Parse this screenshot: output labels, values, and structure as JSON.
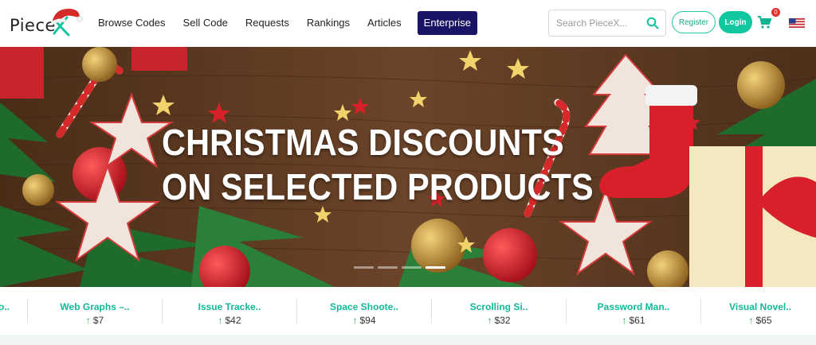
{
  "brand": {
    "name": "Piece"
  },
  "nav": {
    "items": [
      {
        "label": "Browse Codes"
      },
      {
        "label": "Sell Code"
      },
      {
        "label": "Requests"
      },
      {
        "label": "Rankings"
      },
      {
        "label": "Articles"
      }
    ],
    "enterprise_label": "Enterprise",
    "search_placeholder": "Search PieceX...",
    "register_label": "Register",
    "login_label": "Login",
    "cart_count": "0",
    "accent_color": "#10c79f",
    "enterprise_color": "#1a1466"
  },
  "hero": {
    "title_line1": "CHRISTMAS DISCOUNTS",
    "title_line2": "ON SELECTED PRODUCTS",
    "slide_count": 4,
    "active_slide": 4
  },
  "products": [
    {
      "name": "o..",
      "price": ""
    },
    {
      "name": "Web Graphs –..",
      "price": "$7"
    },
    {
      "name": "Issue Tracke..",
      "price": "$42"
    },
    {
      "name": "Space Shoote..",
      "price": "$94"
    },
    {
      "name": "Scrolling Si..",
      "price": "$32"
    },
    {
      "name": "Password Man..",
      "price": "$61"
    },
    {
      "name": "Visual Novel..",
      "price": "$65"
    }
  ]
}
